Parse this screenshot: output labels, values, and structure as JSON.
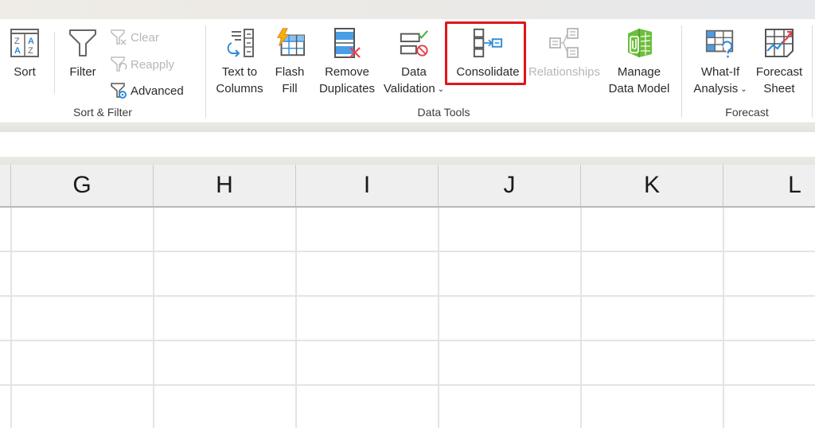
{
  "ribbon": {
    "groups": {
      "sort_filter": {
        "label": "Sort & Filter",
        "sort": {
          "label": "Sort",
          "icon": "sort-az-icon"
        },
        "filter": {
          "label": "Filter",
          "icon": "funnel-icon"
        },
        "clear": {
          "label": "Clear",
          "icon": "clear-filter-icon",
          "enabled": false
        },
        "reapply": {
          "label": "Reapply",
          "icon": "reapply-filter-icon",
          "enabled": false
        },
        "advanced": {
          "label": "Advanced",
          "icon": "advanced-filter-icon",
          "enabled": true
        }
      },
      "data_tools": {
        "label": "Data Tools",
        "text_to_columns": {
          "line1": "Text to",
          "line2": "Columns",
          "icon": "text-to-columns-icon"
        },
        "flash_fill": {
          "line1": "Flash",
          "line2": "Fill",
          "icon": "flash-fill-icon"
        },
        "remove_duplicates": {
          "line1": "Remove",
          "line2": "Duplicates",
          "icon": "remove-duplicates-icon"
        },
        "data_validation": {
          "line1": "Data",
          "line2": "Validation",
          "icon": "data-validation-icon",
          "caret": "⌄"
        },
        "consolidate": {
          "label": "Consolidate",
          "icon": "consolidate-icon",
          "highlighted": true,
          "highlight_color": "#e0141a"
        },
        "relationships": {
          "label": "Relationships",
          "icon": "relationships-icon",
          "enabled": false
        },
        "manage_data_model": {
          "line1": "Manage",
          "line2": "Data Model",
          "icon": "data-model-icon"
        }
      },
      "forecast": {
        "label": "Forecast",
        "what_if": {
          "line1": "What-If",
          "line2": "Analysis",
          "icon": "what-if-icon",
          "caret": "⌄"
        },
        "forecast_sheet": {
          "line1": "Forecast",
          "line2": "Sheet",
          "icon": "forecast-sheet-icon"
        }
      }
    }
  },
  "spreadsheet": {
    "columns": [
      "G",
      "H",
      "I",
      "J",
      "K",
      "L"
    ],
    "visible_rows": 5
  },
  "colors": {
    "accent_blue": "#2e8bd8",
    "delete_red": "#e8414b",
    "model_green": "#6bbf3a",
    "highlight_red": "#e0141a",
    "disabled_gray": "#b7b7b7"
  }
}
